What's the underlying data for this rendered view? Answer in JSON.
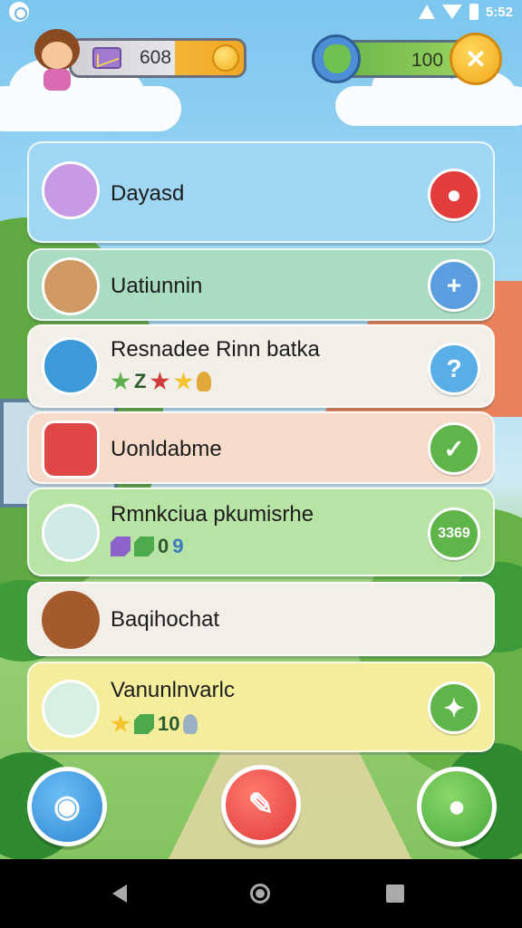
{
  "status_bar": {
    "time": "5:52",
    "icons": [
      "app-icon",
      "signal-icon",
      "wifi-icon",
      "battery-icon"
    ]
  },
  "hud": {
    "coins": {
      "icon": "envelope-icon",
      "value": "608",
      "coin_icon": "coin-icon"
    },
    "health": {
      "icon": "shield-icon",
      "value": "100",
      "button_icon": "tools-icon",
      "button_glyph": "✕"
    }
  },
  "cards": [
    {
      "title": "Dayasd",
      "avatar_icon": "bear-icon",
      "action_icon": "eye-icon",
      "action_glyph": "●",
      "meta": [],
      "color": "#9fd6f3"
    },
    {
      "title": "Uatiunnin",
      "avatar_icon": "bear-icon",
      "action_icon": "plus-icon",
      "action_glyph": "+",
      "meta": [],
      "color": "#a9dcc1"
    },
    {
      "title": "Resnadee Rinn batka",
      "avatar_icon": "scroll-icon",
      "action_icon": "question-icon",
      "action_glyph": "?",
      "meta": [
        "Z"
      ],
      "color": "#f2efe9"
    },
    {
      "title": "Uonldabme",
      "avatar_icon": "redirect-icon",
      "action_icon": "check-icon",
      "action_glyph": "✓",
      "meta": [],
      "color": "#f6dbcb"
    },
    {
      "title": "Rmnkciua pkumisrhe",
      "avatar_icon": "girl-icon",
      "action_icon": "count-icon",
      "action_glyph": "3369",
      "meta": [
        "0",
        "9"
      ],
      "color": "#b7e3a4"
    },
    {
      "title": "Baqihochat",
      "avatar_icon": "bear-icon",
      "action_icon": "",
      "action_glyph": "",
      "meta": [],
      "color": "#f2efe8"
    },
    {
      "title": "Vanunlnvarlc",
      "avatar_icon": "girl-icon",
      "action_icon": "sparkle-icon",
      "action_glyph": "✦",
      "meta": [
        "10"
      ],
      "color": "#f4ee9c"
    }
  ],
  "bottom_buttons": [
    {
      "icon": "photo-icon",
      "glyph": "◉"
    },
    {
      "icon": "hammer-icon",
      "glyph": "✎"
    },
    {
      "icon": "chat-icon",
      "glyph": "●"
    }
  ],
  "colors": {
    "sky": "#7cc6ef",
    "grass": "#7fc25a",
    "red_button": "#e03c3c",
    "blue_button": "#2f86d3",
    "green_button": "#47a83a",
    "gold": "#f2a71c"
  }
}
